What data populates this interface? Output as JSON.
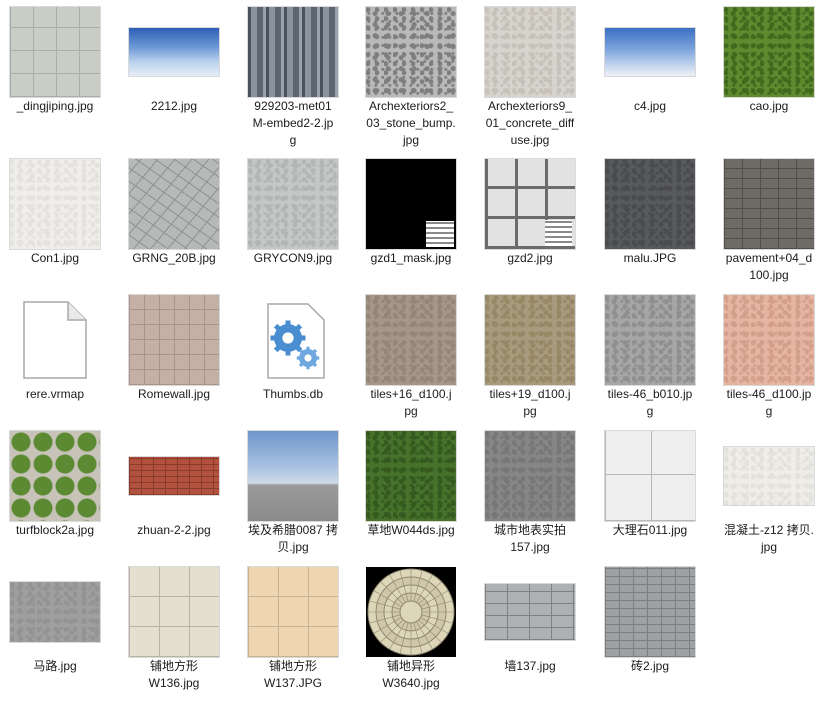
{
  "files": [
    {
      "name": "_dingjiping.jpg",
      "kind": "pavers"
    },
    {
      "name": "2212.jpg",
      "kind": "sky-wide"
    },
    {
      "name": "929203-met01\nM-embed2-2.jp\ng",
      "kind": "metal"
    },
    {
      "name": "Archexteriors2_\n03_stone_bump.\njpg",
      "kind": "stone-bump"
    },
    {
      "name": "Archexteriors9_\n01_concrete_diff\nuse.jpg",
      "kind": "concrete"
    },
    {
      "name": "c4.jpg",
      "kind": "sky-wide2"
    },
    {
      "name": "cao.jpg",
      "kind": "grass"
    },
    {
      "name": "Con1.jpg",
      "kind": "con1"
    },
    {
      "name": "GRNG_20B.jpg",
      "kind": "cracked"
    },
    {
      "name": "GRYCON9.jpg",
      "kind": "grycon"
    },
    {
      "name": "gzd1_mask.jpg",
      "kind": "mask"
    },
    {
      "name": "gzd2.jpg",
      "kind": "gzd2"
    },
    {
      "name": "malu.JPG",
      "kind": "asphalt"
    },
    {
      "name": "pavement+04_d\n100.jpg",
      "kind": "pavement"
    },
    {
      "name": "rere.vrmap",
      "kind": "file-icon"
    },
    {
      "name": "Romewall.jpg",
      "kind": "romewall"
    },
    {
      "name": "Thumbs.db",
      "kind": "gear-icon"
    },
    {
      "name": "tiles+16_d100.j\npg",
      "kind": "tiles16"
    },
    {
      "name": "tiles+19_d100.j\npg",
      "kind": "tiles19"
    },
    {
      "name": "tiles-46_b010.jp\ng",
      "kind": "tiles46b"
    },
    {
      "name": "tiles-46_d100.jp\ng",
      "kind": "tiles46d"
    },
    {
      "name": "turfblock2a.jpg",
      "kind": "turfblock"
    },
    {
      "name": "zhuan-2-2.jpg",
      "kind": "brick-wide"
    },
    {
      "name": "埃及希腊0087 拷\n贝.jpg",
      "kind": "sky-square"
    },
    {
      "name": "草地W044ds.jpg",
      "kind": "grass2"
    },
    {
      "name": "城市地表实拍\n157.jpg",
      "kind": "city-ground"
    },
    {
      "name": "大理石011.jpg",
      "kind": "marble"
    },
    {
      "name": "混凝土-z12 拷贝.\njpg",
      "kind": "concrete-wide"
    },
    {
      "name": "马路.jpg",
      "kind": "road-wide"
    },
    {
      "name": "铺地方形\nW136.jpg",
      "kind": "tiles-beige"
    },
    {
      "name": "铺地方形\nW137.JPG",
      "kind": "tiles-tan"
    },
    {
      "name": "铺地异形\nW3640.jpg",
      "kind": "circle"
    },
    {
      "name": "墙137.jpg",
      "kind": "stonewall"
    },
    {
      "name": "砖2.jpg",
      "kind": "brick-gray"
    }
  ]
}
